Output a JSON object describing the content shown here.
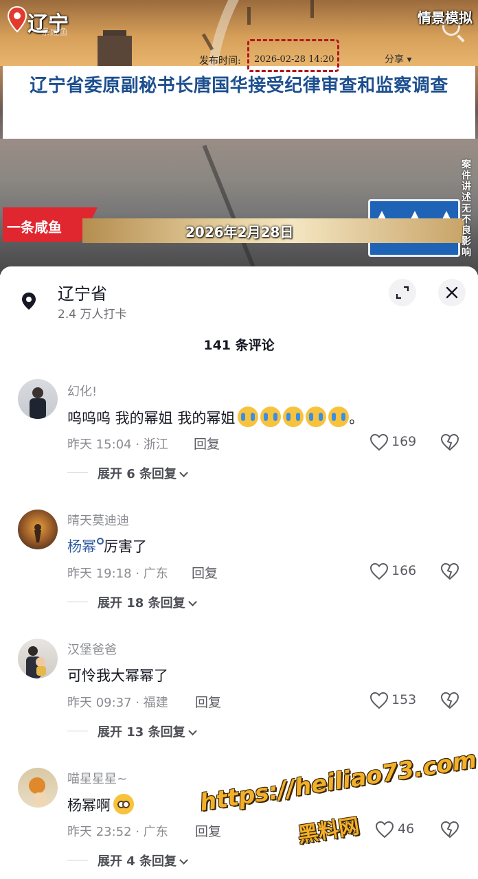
{
  "video": {
    "location_title": "辽宁",
    "watermark_small": "条咸鱼",
    "top_right_label": "情景模拟",
    "headline": "辽宁省委原副秘书长唐国华接受纪律审查和监察调查",
    "publish_label": "发布时间:",
    "publish_date": "2026-02-28 14:20",
    "share_label": "分享",
    "brand_label": "一条咸鱼",
    "date_banner": "2026年2月28日",
    "side_note": "案件讲述 无不良影响"
  },
  "poi": {
    "name": "辽宁省",
    "checkins": "2.4 万人打卡"
  },
  "comment_count": "141 条评论",
  "comments": [
    {
      "user": "幻化!",
      "text": "呜呜呜 我的幂姐 我的幂姐",
      "text_suffix": "。",
      "meta": "昨天 15:04 · 浙江",
      "reply": "回复",
      "likes": "169",
      "expand": "展开 6 条回复"
    },
    {
      "user": "晴天莫迪迪",
      "mention": "杨幂",
      "text": "厉害了",
      "meta": "昨天 19:18 · 广东",
      "reply": "回复",
      "likes": "166",
      "expand": "展开 18 条回复"
    },
    {
      "user": "汉堡爸爸",
      "text": "可怜我大幂幂了",
      "meta": "昨天 09:37 · 福建",
      "reply": "回复",
      "likes": "153",
      "expand": "展开 13 条回复"
    },
    {
      "user": "喵星星星~",
      "text": "杨幂啊",
      "meta": "昨天 23:52 · 广东",
      "reply": "回复",
      "likes": "46",
      "expand": "展开 4 条回复"
    }
  ],
  "watermark": {
    "url": "https://heiliao73.com",
    "name": "黑料网"
  },
  "colors": {
    "headline_blue": "#1d4f8f",
    "brand_red": "#e0262f",
    "mention_blue": "#2c5aa0",
    "watermark_gold": "#f2b02a"
  },
  "icons": [
    "location-pin-icon",
    "search-icon",
    "map-pin-icon",
    "expand-icon",
    "close-icon",
    "heart-icon",
    "broken-heart-icon",
    "chevron-down-icon",
    "search-mini-icon",
    "crying-emoji-icon",
    "pleading-emoji-icon"
  ]
}
